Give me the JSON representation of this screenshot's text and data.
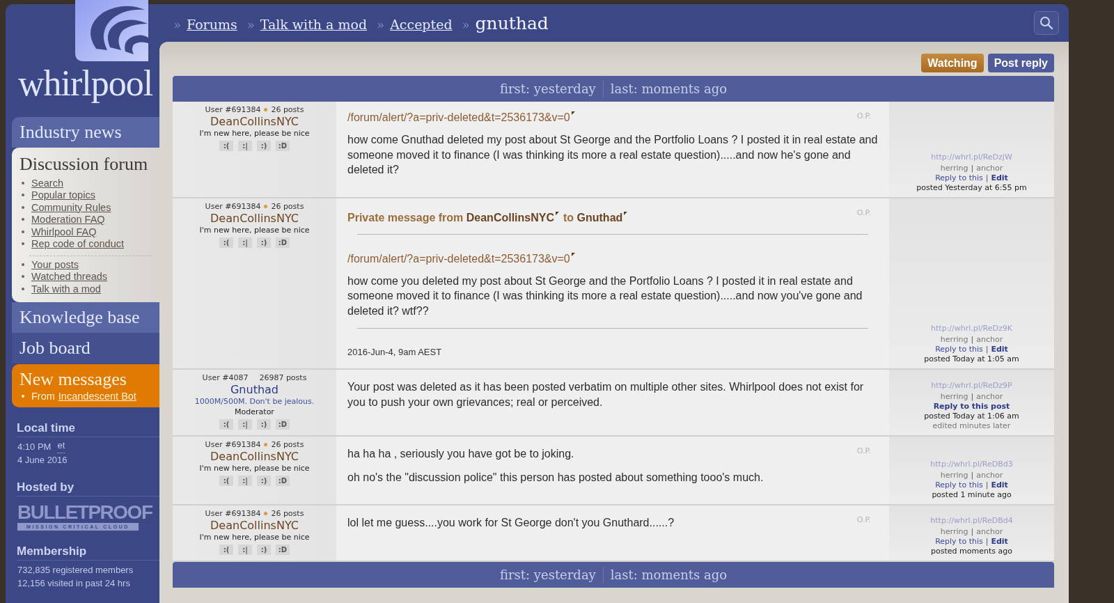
{
  "logo": {
    "text": "whirlpool"
  },
  "nav": [
    {
      "kind": "tab",
      "label": "Industry news"
    },
    {
      "kind": "panel",
      "label": "Discussion forum",
      "groups": [
        [
          "Search",
          "Popular topics",
          "Community Rules",
          "Moderation FAQ",
          "Whirlpool FAQ",
          "Rep code of conduct"
        ],
        [
          "Your posts",
          "Watched threads",
          "Talk with a mod"
        ]
      ]
    },
    {
      "kind": "tab",
      "label": "Knowledge base"
    },
    {
      "kind": "plain",
      "label": "Job board"
    },
    {
      "kind": "alert",
      "label": "New messages",
      "from_label": "From",
      "from_link": "Incandescent Bot"
    }
  ],
  "local_time": {
    "title": "Local time",
    "time": "4:10 PM",
    "zone": "et",
    "date": "4 June 2016"
  },
  "hosted_by": {
    "title": "Hosted by",
    "brand": "BULLETPROOF",
    "tagline": "MISSION CRITICAL CLOUD"
  },
  "membership": {
    "title": "Membership",
    "lines": [
      "732,835 registered members",
      "12,156 visited in past 24 hrs"
    ]
  },
  "breadcrumbs": [
    {
      "sep": "»",
      "label": "Forums",
      "link": true
    },
    {
      "sep": "»",
      "label": "Talk with a mod",
      "link": true
    },
    {
      "sep": "»",
      "label": "Accepted",
      "link": true
    },
    {
      "sep": "»",
      "label": "gnuthad",
      "link": false
    }
  ],
  "actions": [
    {
      "label": "Watching",
      "kind": "watch"
    },
    {
      "label": "Post reply",
      "kind": "primary"
    }
  ],
  "thread_bar": {
    "first": "first: yesterday",
    "last": "last: moments ago"
  },
  "posts": [
    {
      "user_id": "User #691384",
      "dot": true,
      "post_count": "26 posts",
      "username": "DeanCollinsNYC",
      "kind": "member",
      "tagline": "I'm new here, please be nice",
      "ratings": [
        ":(",
        ":|",
        ":)",
        ":D"
      ],
      "op": "O.P.",
      "body": [
        {
          "kind": "link",
          "text": "/forum/alert/?a=priv-deleted&t=2536173&v=0"
        },
        {
          "kind": "text",
          "text": "how come Gnuthad deleted my post about St George and the Portfolio Loans ? I posted it in real estate and someone moved it to finance (I was thinking its more a real estate question).....and now he's gone and deleted it?"
        }
      ],
      "short_url": "http://whrl.pl/ReDzjW",
      "herring": "herring",
      "divider": "|",
      "anchor": "anchor",
      "reply": "Reply to this",
      "reply_bold": false,
      "edit": "Edit",
      "posted": "posted Yesterday at 6:55 pm"
    },
    {
      "user_id": "User #691384",
      "dot": true,
      "post_count": "26 posts",
      "username": "DeanCollinsNYC",
      "kind": "member",
      "tagline": "I'm new here, please be nice",
      "ratings": [
        ":(",
        ":|",
        ":)",
        ":D"
      ],
      "op": "O.P.",
      "body": [
        {
          "kind": "pm_heading",
          "parts": [
            "Private message from **DeanCollinsNYC**",
            "to **Gnuthad**"
          ]
        },
        {
          "kind": "rule"
        },
        {
          "kind": "link",
          "text": "/forum/alert/?a=priv-deleted&t=2536173&v=0"
        },
        {
          "kind": "text",
          "text": "how come you deleted my post about St George and the Portfolio Loans ? I posted it in real estate and someone moved it to finance (I was thinking its more a real estate question).....and now you've gone and deleted it? wtf??"
        },
        {
          "kind": "rule"
        },
        {
          "kind": "date",
          "text": "2016-Jun-4, 9am AEST"
        }
      ],
      "short_url": "http://whrl.pl/ReDz9K",
      "herring": "herring",
      "divider": "|",
      "anchor": "anchor",
      "reply": "Reply to this",
      "reply_bold": false,
      "edit": "Edit",
      "posted": "posted Today at 1:05 am"
    },
    {
      "user_id": "User #4087",
      "dot": false,
      "post_count": "26987 posts",
      "username": "Gnuthad",
      "kind": "moderator",
      "tagline": "1000M/500M. Don't be jealous.",
      "role": "Moderator",
      "ratings": [
        ":(",
        ":|",
        ":)",
        ":D"
      ],
      "body": [
        {
          "kind": "text",
          "text": "Your post was deleted as it has been posted verbatim on multiple other sites. Whirlpool does not exist for you to push your own grievances; real or perceived."
        }
      ],
      "short_url": "http://whrl.pl/ReDz9P",
      "herring": "herring",
      "divider": "|",
      "anchor": "anchor",
      "reply": "Reply to this post",
      "reply_bold": true,
      "posted": "posted Today at 1:06 am",
      "edited": "edited minutes later"
    },
    {
      "user_id": "User #691384",
      "dot": true,
      "post_count": "26 posts",
      "username": "DeanCollinsNYC",
      "kind": "member",
      "tagline": "I'm new here, please be nice",
      "ratings": [
        ":(",
        ":|",
        ":)",
        ":D"
      ],
      "op": "O.P.",
      "body": [
        {
          "kind": "text",
          "text": "ha ha ha , seriously you have got be to joking."
        },
        {
          "kind": "text",
          "text": "oh no's the \"discussion police\" this person has posted about something tooo's much."
        }
      ],
      "short_url": "http://whrl.pl/ReDBd3",
      "herring": "herring",
      "divider": "|",
      "anchor": "anchor",
      "reply": "Reply to this",
      "reply_bold": false,
      "edit": "Edit",
      "posted": "posted 1 minute ago"
    },
    {
      "user_id": "User #691384",
      "dot": true,
      "post_count": "26 posts",
      "username": "DeanCollinsNYC",
      "kind": "member",
      "tagline": "I'm new here, please be nice",
      "ratings": [
        ":(",
        ":|",
        ":)",
        ":D"
      ],
      "op": "O.P.",
      "body": [
        {
          "kind": "text",
          "text": "lol let me guess....you work for St George don't you Gnuthard......?"
        }
      ],
      "short_url": "http://whrl.pl/ReDBd4",
      "herring": "herring",
      "divider": "|",
      "anchor": "anchor",
      "reply": "Reply to this",
      "reply_bold": false,
      "edit": "Edit",
      "posted": "posted moments ago"
    }
  ],
  "bottom_bar": {
    "first": "first: yesterday",
    "last": "last: moments ago"
  }
}
